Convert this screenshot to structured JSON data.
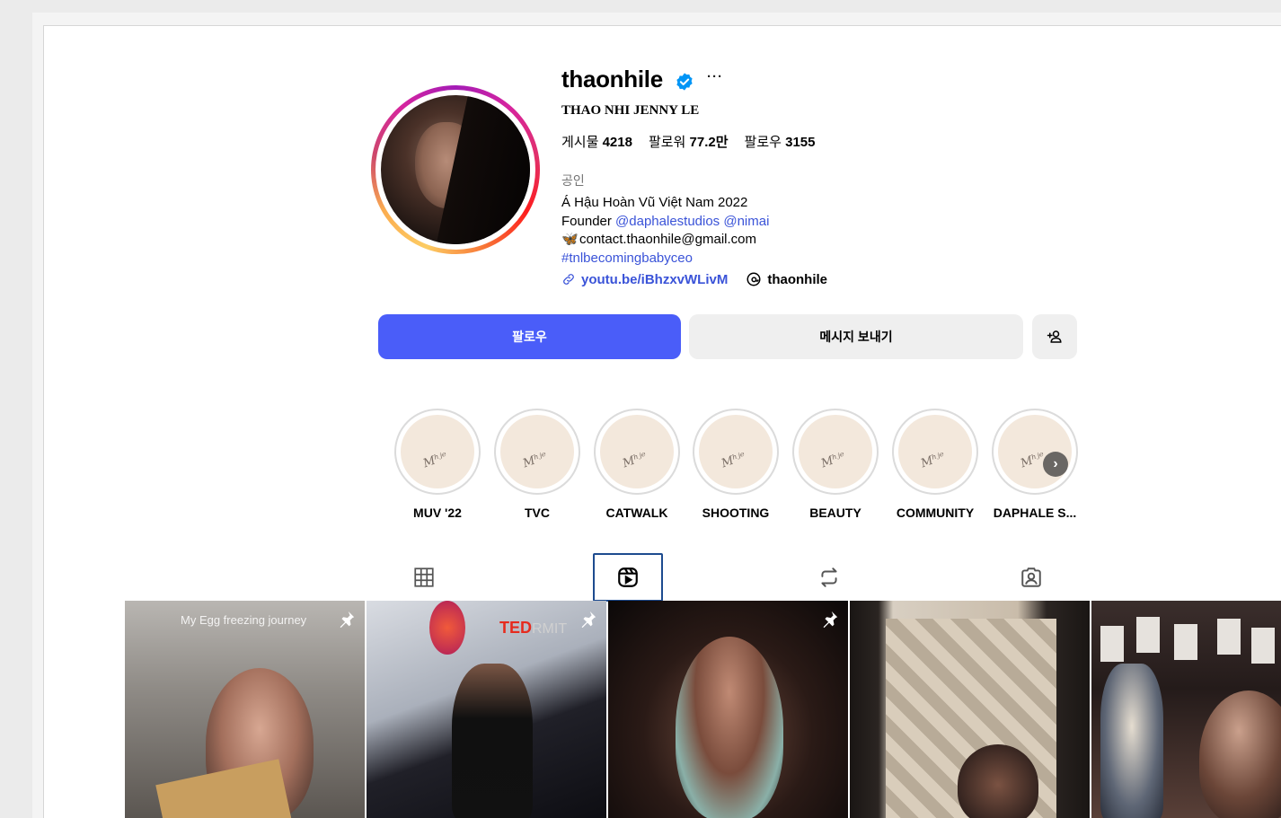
{
  "profile": {
    "username": "thaonhile",
    "more_label": "···",
    "full_name": "THAO NHI JENNY LE",
    "stats": {
      "posts_label": "게시물",
      "posts_value": "4218",
      "followers_label": "팔로워",
      "followers_value": "77.2만",
      "following_label": "팔로우",
      "following_value": "3155"
    },
    "category": "공인",
    "bio": {
      "line1": "Á Hậu Hoàn Vũ Việt Nam 2022",
      "founder_prefix": "Founder ",
      "mention1": "@daphalestudios",
      "mention2": "@nimai",
      "butterfly": "🦋",
      "email": "contact.thaonhile@gmail.com",
      "hashtag": "#tnlbecomingbabyceo"
    },
    "link": "youtu.be/iBhzxvWLivM",
    "threads_handle": "thaonhile"
  },
  "actions": {
    "follow_label": "팔로우",
    "message_label": "메시지 보내기",
    "add_user_label": "+"
  },
  "highlights": [
    {
      "label": "MUV '22"
    },
    {
      "label": "TVC"
    },
    {
      "label": "CATWALK"
    },
    {
      "label": "SHOOTING"
    },
    {
      "label": "BEAUTY"
    },
    {
      "label": "COMMUNITY"
    },
    {
      "label": "DAPHALE S..."
    }
  ],
  "highlight_signature": "Mʰʲᵉ",
  "tabs": [
    {
      "name": "posts",
      "icon": "grid-icon",
      "active": false
    },
    {
      "name": "reels",
      "icon": "reels-icon",
      "active": true
    },
    {
      "name": "reposts",
      "icon": "repost-icon",
      "active": false
    },
    {
      "name": "tagged",
      "icon": "tagged-icon",
      "active": false
    }
  ],
  "posts": [
    {
      "overlay_text": "My Egg freezing journey",
      "pinned": true
    },
    {
      "overlay_text": "TED",
      "overlay_sub": "RMIT",
      "pinned": true
    },
    {
      "overlay_text": "",
      "pinned": true
    },
    {
      "overlay_text": "",
      "pinned": false
    },
    {
      "overlay_text": "",
      "pinned": false
    }
  ],
  "colors": {
    "follow_button": "#4a5df9",
    "link": "#3a53d8",
    "verified": "#0095f6",
    "active_tab_border": "#1d4b8f"
  }
}
